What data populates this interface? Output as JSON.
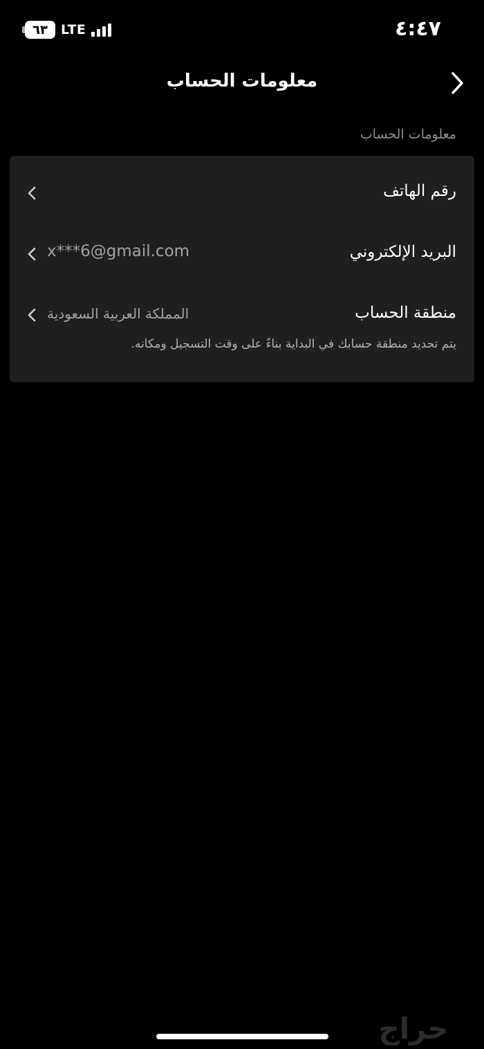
{
  "status_bar": {
    "time": "٤:٤٧",
    "battery_level": "٦٣",
    "network_type": "LTE"
  },
  "header": {
    "title": "معلومات الحساب",
    "back_icon": "chevron-right-icon"
  },
  "section": {
    "label": "معلومات الحساب"
  },
  "rows": [
    {
      "label": "رقم الهاتف",
      "value": ""
    },
    {
      "label": "البريد الإلكتروني",
      "value": "x***6@gmail.com"
    },
    {
      "label": "منطقة الحساب",
      "value": "المملكة العربية السعودية"
    }
  ],
  "region_note": "يتم تحديد منطقة حسابك في البداية بناءً على وقت التسجيل ومكانه.",
  "watermark": "حراج",
  "colors": {
    "background": "#000000",
    "card": "#1f1f1f",
    "secondary_text": "#a3a3a3",
    "section_label": "#8e8e8e"
  }
}
